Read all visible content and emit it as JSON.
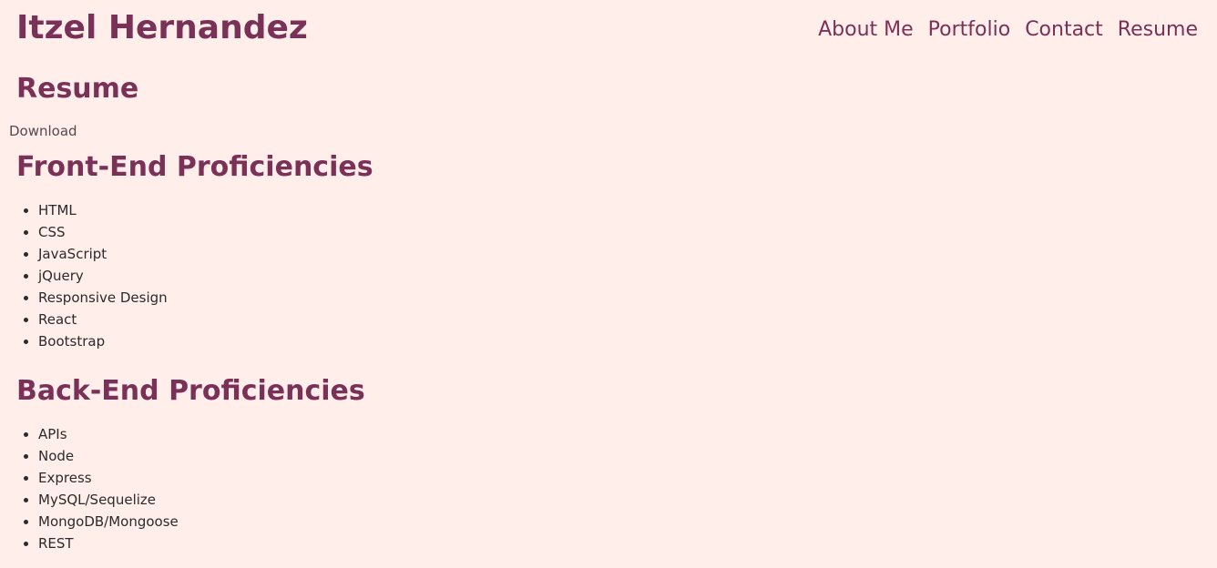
{
  "header": {
    "title": "Itzel Hernandez",
    "nav": [
      {
        "label": "About Me"
      },
      {
        "label": "Portfolio"
      },
      {
        "label": "Contact"
      },
      {
        "label": "Resume"
      }
    ]
  },
  "resume": {
    "heading": "Resume",
    "download_label": "Download"
  },
  "front_end": {
    "heading": "Front-End Proficiencies",
    "items": [
      "HTML",
      "CSS",
      "JavaScript",
      "jQuery",
      "Responsive Design",
      "React",
      "Bootstrap"
    ]
  },
  "back_end": {
    "heading": "Back-End Proficiencies",
    "items": [
      "APIs",
      "Node",
      "Express",
      "MySQL/Sequelize",
      "MongoDB/Mongoose",
      "REST"
    ]
  },
  "colors": {
    "background": "#ffeee9",
    "accent": "#7a3158",
    "body_text": "#2b2b2b"
  }
}
